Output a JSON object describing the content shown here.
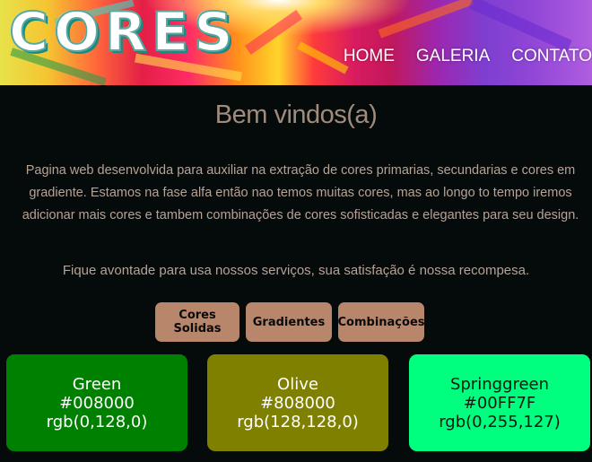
{
  "header": {
    "logo": "CORES",
    "nav": [
      "HOME",
      "GALERIA",
      "CONTATO"
    ]
  },
  "main": {
    "title": "Bem vindos(a)",
    "intro": "Pagina web desenvolvida para auxiliar na extração de cores primarias, secundarias e cores em gradiente. Estamos na fase alfa então nao temos muitas cores, mas ao longo to tempo iremos adicionar mais cores e tambem combinações de cores sofisticadas e elegantes para seu design.",
    "invite": "Fique avontade para usa nossos serviços, sua satisfação é nossa recompesa."
  },
  "tabs": [
    "Cores Solidas",
    "Gradientes",
    "Combinações"
  ],
  "colors": [
    {
      "name": "Green",
      "hex": "#008000",
      "rgb": "rgb(0,128,0)"
    },
    {
      "name": "Olive",
      "hex": "#808000",
      "rgb": "rgb(128,128,0)"
    },
    {
      "name": "Springgreen",
      "hex": "#00FF7F",
      "rgb": "rgb(0,255,127)"
    }
  ],
  "theme": {
    "background": "#050a0b",
    "heading_text": "#a18b7c",
    "body_text": "#b8a294",
    "tab_background": "#b8876b"
  }
}
